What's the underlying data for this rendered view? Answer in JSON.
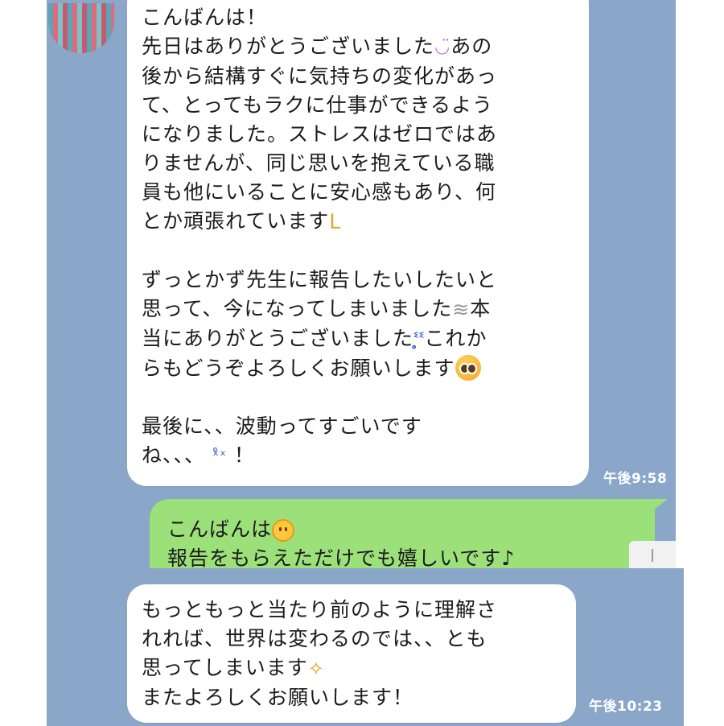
{
  "messages": {
    "received_1": {
      "lines": [
        "こんばんは！",
        "先日はありがとうございました",
        "あの",
        "後から結構すぐに気持ちの変化があっ",
        "て、とってもラクに仕事ができるよう",
        "になりました。ストレスはゼロではあ",
        "りませんが、同じ思いを抱えている職",
        "員も他にいることに安心感もあり、何",
        "とか頑張れています",
        "ずっとかず先生に報告したいしたいと",
        "思って、今になってしまいました",
        "本",
        "当にありがとうございました",
        "これか",
        "らもどうぞよろしくお願いします",
        "最後に、、波動ってすごいです",
        "ね、、、",
        "！"
      ],
      "time": "午後9:58"
    },
    "sent_1": {
      "lines": [
        "こんばんは",
        "報告をもらえただけでも嬉しいです♪"
      ]
    },
    "received_2": {
      "lines": [
        "もっともっと当たり前のように理解さ",
        "れれば、世界は変わるのでは、、とも",
        "思ってしまいます",
        "またよろしくお願いします！"
      ],
      "time": "午後10:23"
    }
  },
  "icons": {
    "smile": "smiling-eyes-icon",
    "flex": "flexed-biceps-icon",
    "puff": "dash-puff-icon",
    "cry": "crying-face-icon",
    "plead": "pleading-face-icon",
    "shock": "astonished-face-icon",
    "happy": "smiling-face-icon",
    "sparkles": "sparkles-icon"
  },
  "colors": {
    "background": "#8aa6c8",
    "received_bubble": "#ffffff",
    "sent_bubble": "#9ce07a",
    "timestamp": "#ffffff"
  }
}
